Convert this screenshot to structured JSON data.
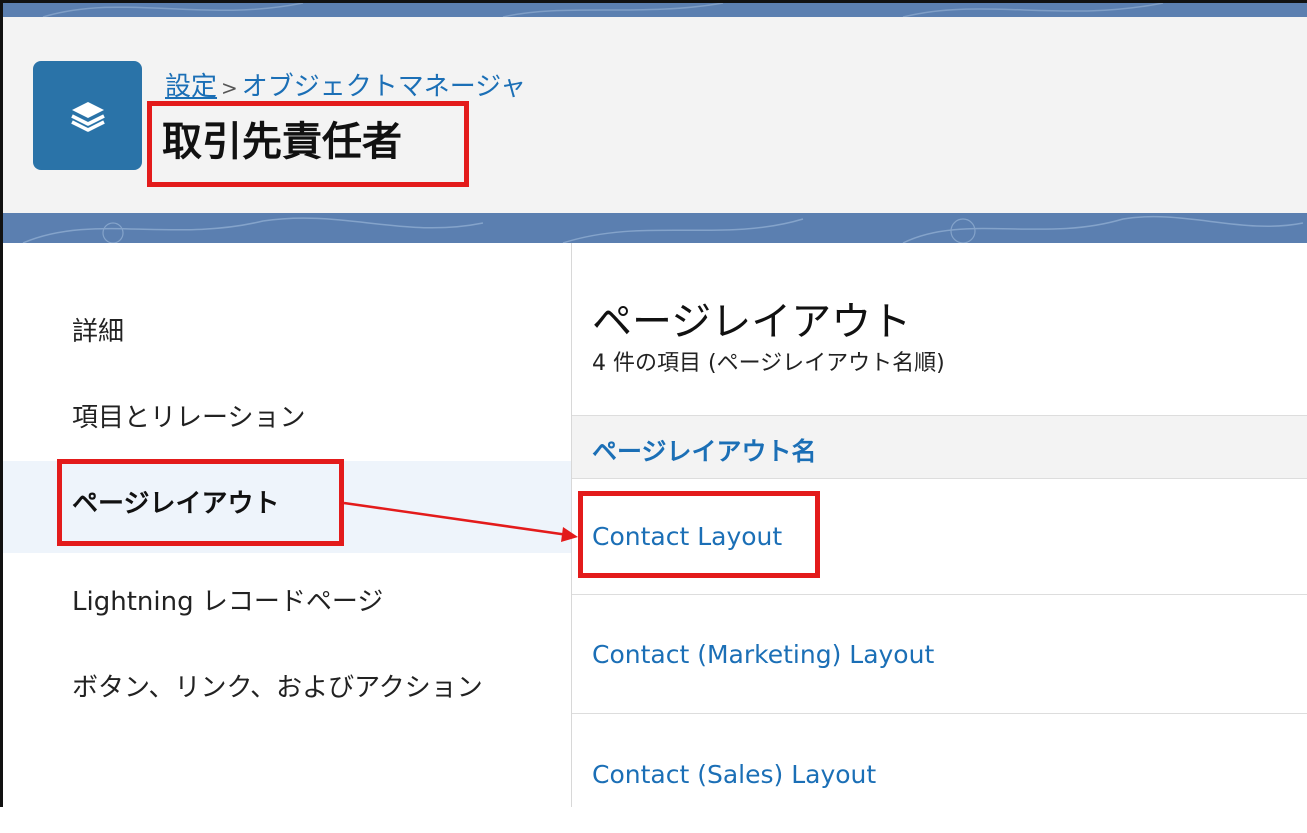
{
  "header": {
    "breadcrumb": {
      "root": "設定",
      "separator": ">",
      "current": "オブジェクトマネージャ"
    },
    "title": "取引先責任者",
    "icon": "layers-icon",
    "icon_bg": "#2a73a8"
  },
  "sidebar": {
    "items": [
      {
        "label": "詳細"
      },
      {
        "label": "項目とリレーション"
      },
      {
        "label": "ページレイアウト",
        "active": true
      },
      {
        "label": "Lightning レコードページ"
      },
      {
        "label": "ボタン、リンク、およびアクション"
      }
    ]
  },
  "main": {
    "title": "ページレイアウト",
    "subtitle": "4 件の項目 (ページレイアウト名順)",
    "column_header": "ページレイアウト名",
    "rows": [
      {
        "name": "Contact Layout"
      },
      {
        "name": "Contact (Marketing) Layout"
      },
      {
        "name": "Contact (Sales) Layout"
      }
    ]
  },
  "annotation": {
    "color": "#e31b1b"
  }
}
